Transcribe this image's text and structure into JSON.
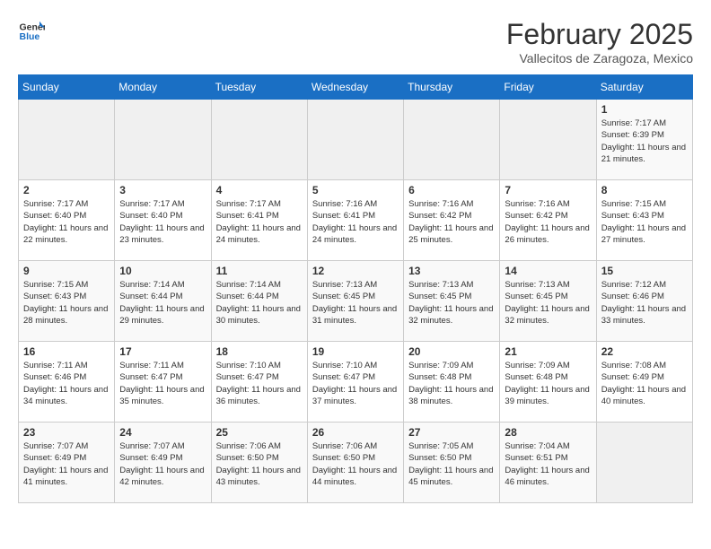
{
  "logo": {
    "line1": "General",
    "line2": "Blue"
  },
  "title": "February 2025",
  "subtitle": "Vallecitos de Zaragoza, Mexico",
  "days_of_week": [
    "Sunday",
    "Monday",
    "Tuesday",
    "Wednesday",
    "Thursday",
    "Friday",
    "Saturday"
  ],
  "weeks": [
    [
      {
        "day": "",
        "info": ""
      },
      {
        "day": "",
        "info": ""
      },
      {
        "day": "",
        "info": ""
      },
      {
        "day": "",
        "info": ""
      },
      {
        "day": "",
        "info": ""
      },
      {
        "day": "",
        "info": ""
      },
      {
        "day": "1",
        "info": "Sunrise: 7:17 AM\nSunset: 6:39 PM\nDaylight: 11 hours and 21 minutes."
      }
    ],
    [
      {
        "day": "2",
        "info": "Sunrise: 7:17 AM\nSunset: 6:40 PM\nDaylight: 11 hours and 22 minutes."
      },
      {
        "day": "3",
        "info": "Sunrise: 7:17 AM\nSunset: 6:40 PM\nDaylight: 11 hours and 23 minutes."
      },
      {
        "day": "4",
        "info": "Sunrise: 7:17 AM\nSunset: 6:41 PM\nDaylight: 11 hours and 24 minutes."
      },
      {
        "day": "5",
        "info": "Sunrise: 7:16 AM\nSunset: 6:41 PM\nDaylight: 11 hours and 24 minutes."
      },
      {
        "day": "6",
        "info": "Sunrise: 7:16 AM\nSunset: 6:42 PM\nDaylight: 11 hours and 25 minutes."
      },
      {
        "day": "7",
        "info": "Sunrise: 7:16 AM\nSunset: 6:42 PM\nDaylight: 11 hours and 26 minutes."
      },
      {
        "day": "8",
        "info": "Sunrise: 7:15 AM\nSunset: 6:43 PM\nDaylight: 11 hours and 27 minutes."
      }
    ],
    [
      {
        "day": "9",
        "info": "Sunrise: 7:15 AM\nSunset: 6:43 PM\nDaylight: 11 hours and 28 minutes."
      },
      {
        "day": "10",
        "info": "Sunrise: 7:14 AM\nSunset: 6:44 PM\nDaylight: 11 hours and 29 minutes."
      },
      {
        "day": "11",
        "info": "Sunrise: 7:14 AM\nSunset: 6:44 PM\nDaylight: 11 hours and 30 minutes."
      },
      {
        "day": "12",
        "info": "Sunrise: 7:13 AM\nSunset: 6:45 PM\nDaylight: 11 hours and 31 minutes."
      },
      {
        "day": "13",
        "info": "Sunrise: 7:13 AM\nSunset: 6:45 PM\nDaylight: 11 hours and 32 minutes."
      },
      {
        "day": "14",
        "info": "Sunrise: 7:13 AM\nSunset: 6:45 PM\nDaylight: 11 hours and 32 minutes."
      },
      {
        "day": "15",
        "info": "Sunrise: 7:12 AM\nSunset: 6:46 PM\nDaylight: 11 hours and 33 minutes."
      }
    ],
    [
      {
        "day": "16",
        "info": "Sunrise: 7:11 AM\nSunset: 6:46 PM\nDaylight: 11 hours and 34 minutes."
      },
      {
        "day": "17",
        "info": "Sunrise: 7:11 AM\nSunset: 6:47 PM\nDaylight: 11 hours and 35 minutes."
      },
      {
        "day": "18",
        "info": "Sunrise: 7:10 AM\nSunset: 6:47 PM\nDaylight: 11 hours and 36 minutes."
      },
      {
        "day": "19",
        "info": "Sunrise: 7:10 AM\nSunset: 6:47 PM\nDaylight: 11 hours and 37 minutes."
      },
      {
        "day": "20",
        "info": "Sunrise: 7:09 AM\nSunset: 6:48 PM\nDaylight: 11 hours and 38 minutes."
      },
      {
        "day": "21",
        "info": "Sunrise: 7:09 AM\nSunset: 6:48 PM\nDaylight: 11 hours and 39 minutes."
      },
      {
        "day": "22",
        "info": "Sunrise: 7:08 AM\nSunset: 6:49 PM\nDaylight: 11 hours and 40 minutes."
      }
    ],
    [
      {
        "day": "23",
        "info": "Sunrise: 7:07 AM\nSunset: 6:49 PM\nDaylight: 11 hours and 41 minutes."
      },
      {
        "day": "24",
        "info": "Sunrise: 7:07 AM\nSunset: 6:49 PM\nDaylight: 11 hours and 42 minutes."
      },
      {
        "day": "25",
        "info": "Sunrise: 7:06 AM\nSunset: 6:50 PM\nDaylight: 11 hours and 43 minutes."
      },
      {
        "day": "26",
        "info": "Sunrise: 7:06 AM\nSunset: 6:50 PM\nDaylight: 11 hours and 44 minutes."
      },
      {
        "day": "27",
        "info": "Sunrise: 7:05 AM\nSunset: 6:50 PM\nDaylight: 11 hours and 45 minutes."
      },
      {
        "day": "28",
        "info": "Sunrise: 7:04 AM\nSunset: 6:51 PM\nDaylight: 11 hours and 46 minutes."
      },
      {
        "day": "",
        "info": ""
      }
    ]
  ]
}
